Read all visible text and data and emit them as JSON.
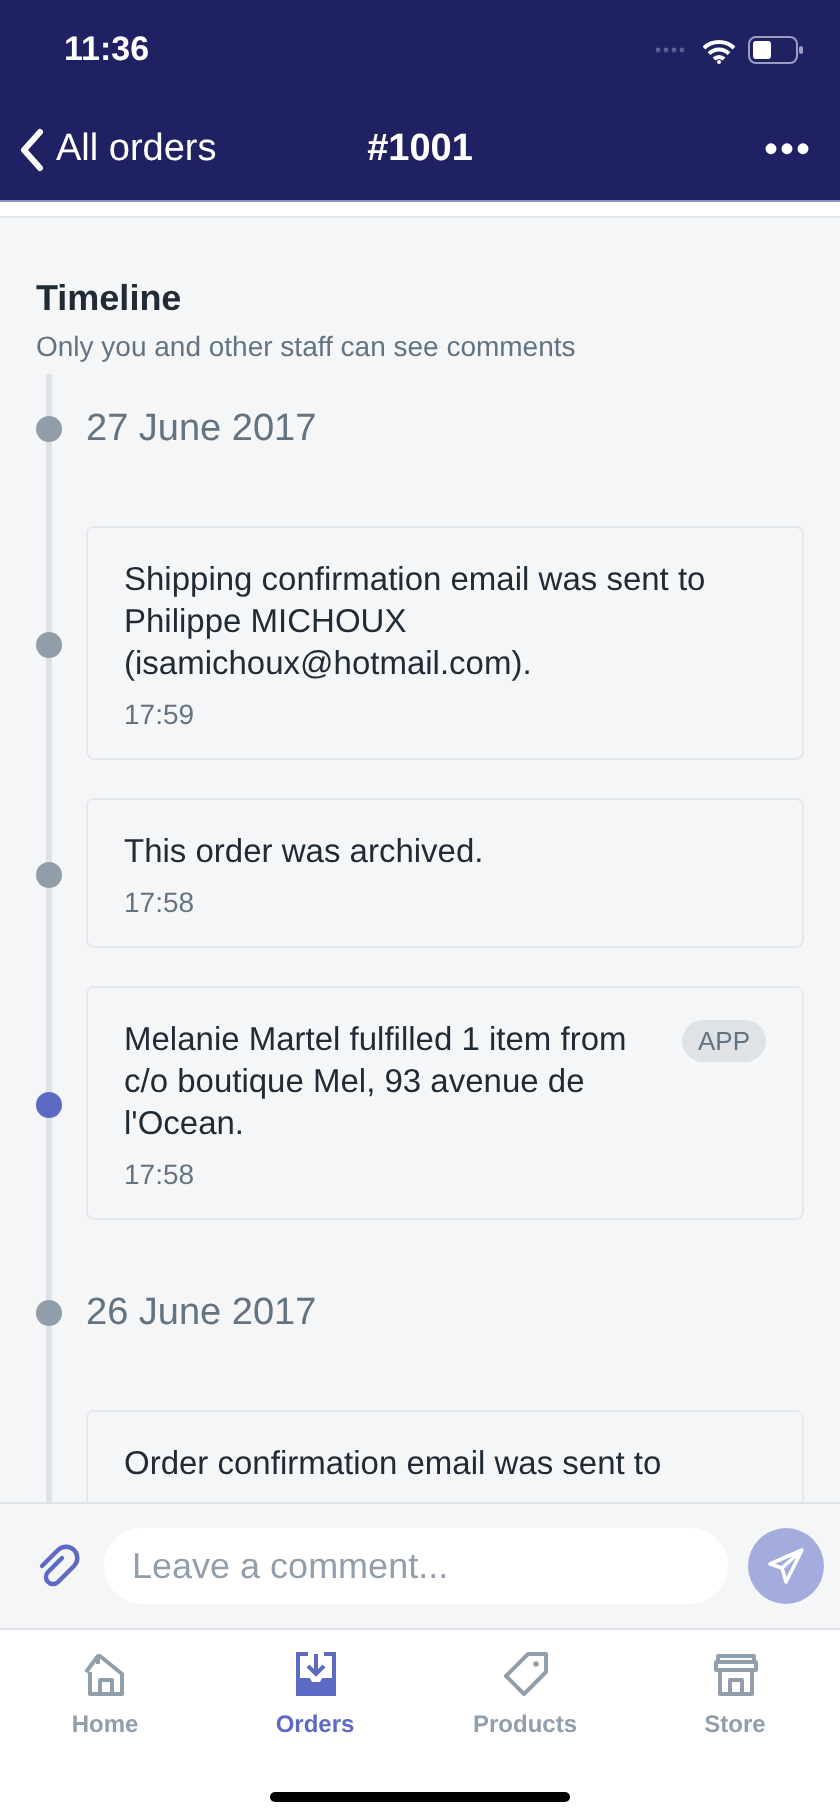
{
  "status_bar": {
    "time": "11:36"
  },
  "nav": {
    "back": "All orders",
    "title": "#1001",
    "more": "•••"
  },
  "timeline": {
    "title": "Timeline",
    "subtitle": "Only you and other staff can see comments",
    "entries": [
      {
        "kind": "date",
        "text": "27 June 2017",
        "color": "#929daa"
      },
      {
        "kind": "event",
        "text": "Shipping confirmation email was sent to Philippe MICHOUX (isamichoux@hotmail.com).",
        "time": "17:59",
        "color": "#929daa"
      },
      {
        "kind": "event",
        "text": "This order was archived.",
        "time": "17:58",
        "color": "#929daa"
      },
      {
        "kind": "event",
        "text": "Melanie Martel fulfilled 1 item from c/o boutique Mel, 93 avenue de l'Ocean.",
        "time": "17:58",
        "badge": "APP",
        "color": "#5c6ac4"
      },
      {
        "kind": "date",
        "text": "26 June 2017",
        "color": "#929daa"
      },
      {
        "kind": "event",
        "text": "Order confirmation email was sent to"
      }
    ]
  },
  "composer": {
    "placeholder": "Leave a comment..."
  },
  "tabs": [
    {
      "label": "Home",
      "selected": false
    },
    {
      "label": "Orders",
      "selected": true
    },
    {
      "label": "Products",
      "selected": false
    },
    {
      "label": "Store",
      "selected": false
    }
  ]
}
